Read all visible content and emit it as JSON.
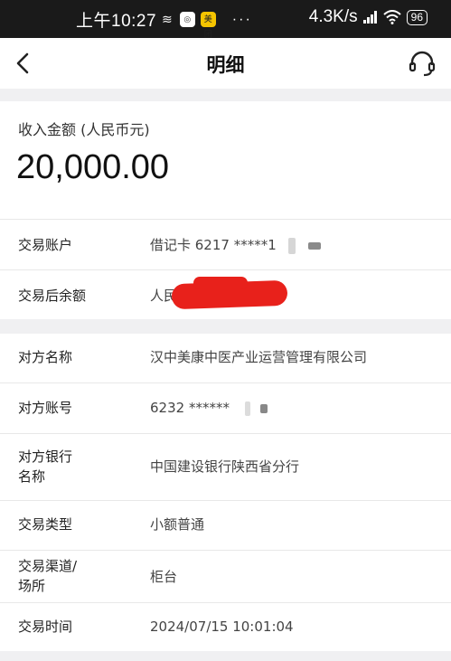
{
  "status_bar": {
    "time": "上午10:27",
    "notif_glyph": "≋",
    "app_badge_1": "◎",
    "app_badge_2": "美团",
    "dots": "···",
    "net_speed": "4.3K/s",
    "battery": "96"
  },
  "nav": {
    "title": "明细",
    "back_icon": "chevron-left-icon",
    "service_icon": "headset-icon"
  },
  "income": {
    "label": "收入金额 (人民币元)",
    "amount": "20,000.00"
  },
  "account": {
    "label": "交易账户",
    "value": "借记卡 6217 *****1"
  },
  "balance": {
    "label": "交易后余额",
    "value": "人民"
  },
  "counterparty": {
    "name_label": "对方名称",
    "name_value": "汉中美康中医产业运营管理有限公司",
    "acct_label": "对方账号",
    "acct_value": "6232 ******",
    "bank_label_line1": "对方银行",
    "bank_label_line2": "名称",
    "bank_value": "中国建设银行陕西省分行"
  },
  "txn": {
    "type_label": "交易类型",
    "type_value": "小额普通",
    "channel_label_line1": "交易渠道/",
    "channel_label_line2": "场所",
    "channel_value": "柜台",
    "time_label": "交易时间",
    "time_value": "2024/07/15 10:01:04"
  },
  "colors": {
    "redaction": "#e8211b",
    "background_band": "#f0f0f2"
  }
}
